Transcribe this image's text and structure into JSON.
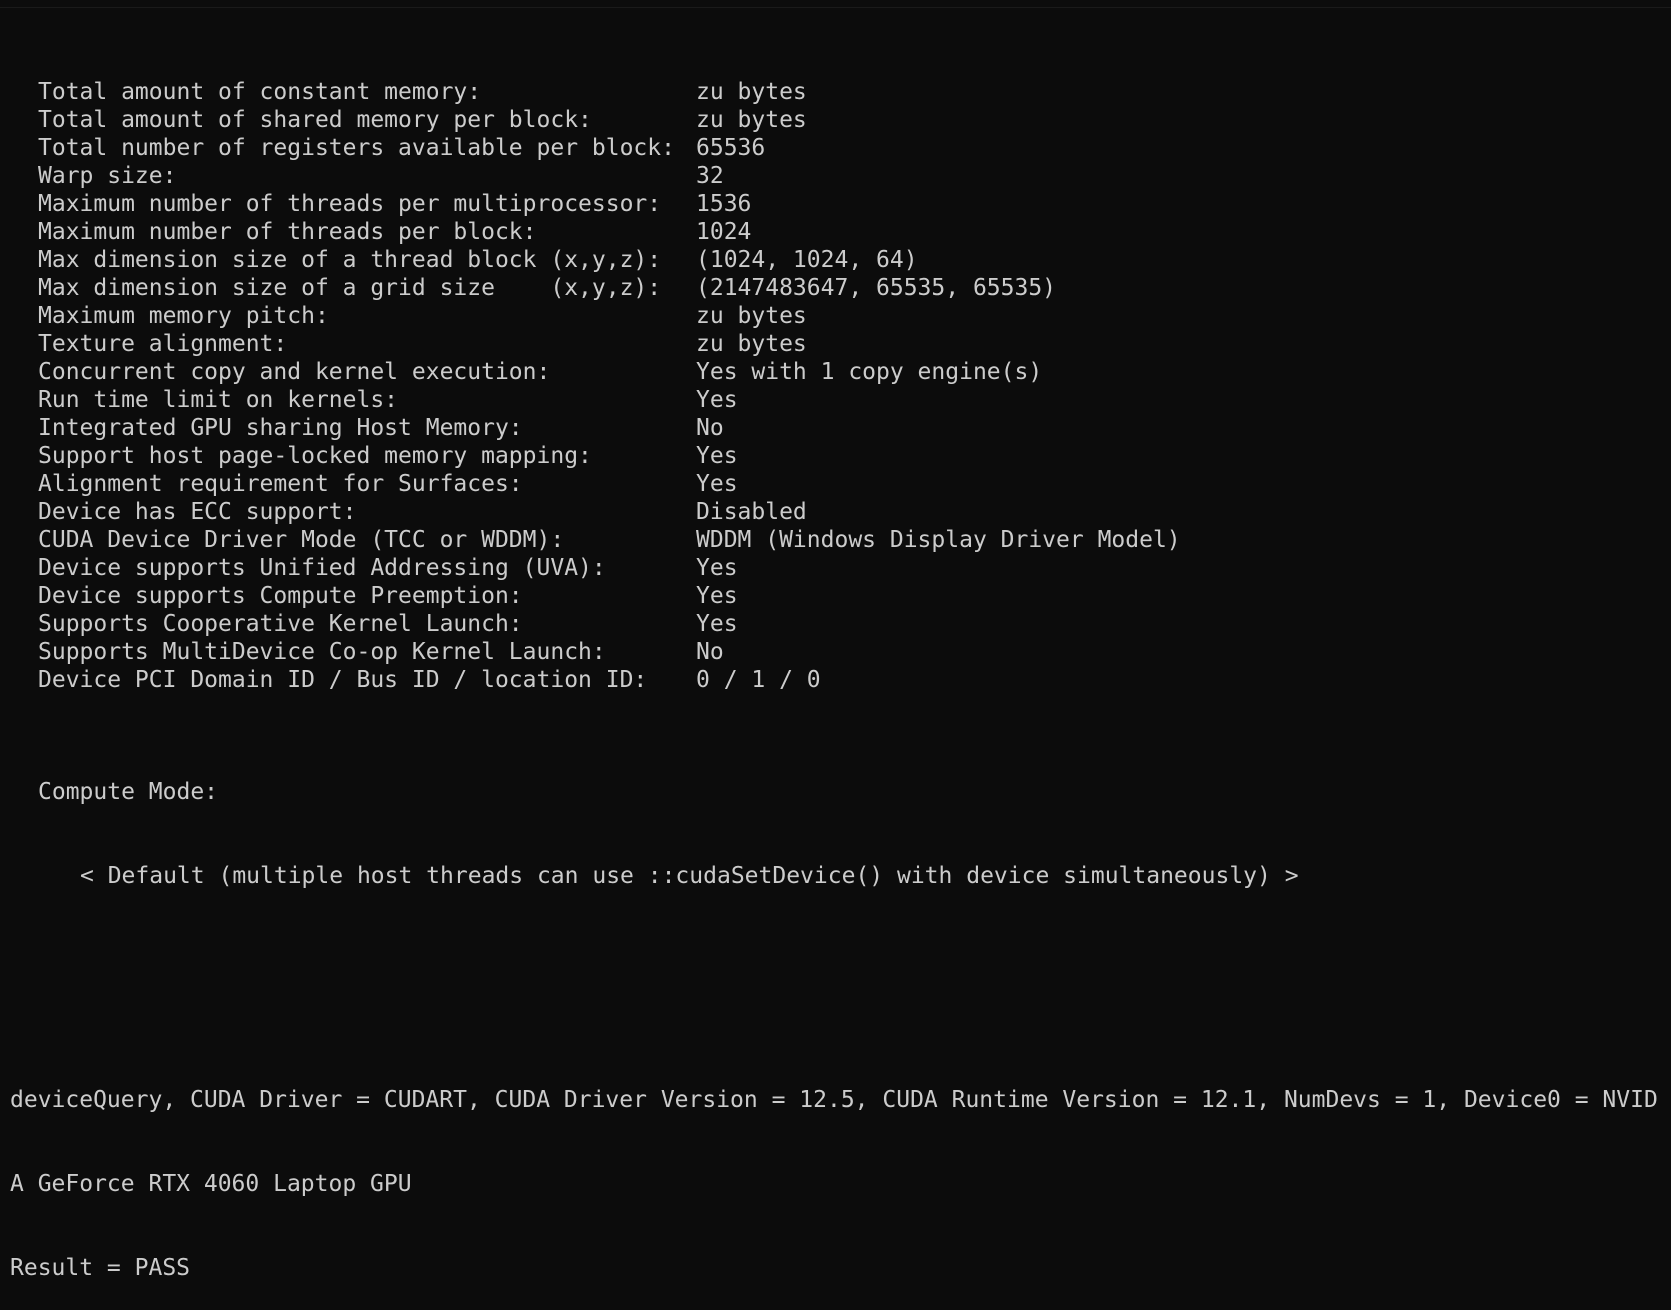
{
  "terminal": {
    "properties": [
      {
        "label": "Total amount of constant memory:",
        "value": "zu bytes"
      },
      {
        "label": "Total amount of shared memory per block:",
        "value": "zu bytes"
      },
      {
        "label": "Total number of registers available per block:",
        "value": "65536"
      },
      {
        "label": "Warp size:",
        "value": "32"
      },
      {
        "label": "Maximum number of threads per multiprocessor:",
        "value": "1536"
      },
      {
        "label": "Maximum number of threads per block:",
        "value": "1024"
      },
      {
        "label": "Max dimension size of a thread block (x,y,z):",
        "value": "(1024, 1024, 64)"
      },
      {
        "label": "Max dimension size of a grid size    (x,y,z):",
        "value": "(2147483647, 65535, 65535)"
      },
      {
        "label": "Maximum memory pitch:",
        "value": "zu bytes"
      },
      {
        "label": "Texture alignment:",
        "value": "zu bytes"
      },
      {
        "label": "Concurrent copy and kernel execution:",
        "value": "Yes with 1 copy engine(s)"
      },
      {
        "label": "Run time limit on kernels:",
        "value": "Yes"
      },
      {
        "label": "Integrated GPU sharing Host Memory:",
        "value": "No"
      },
      {
        "label": "Support host page-locked memory mapping:",
        "value": "Yes"
      },
      {
        "label": "Alignment requirement for Surfaces:",
        "value": "Yes"
      },
      {
        "label": "Device has ECC support:",
        "value": "Disabled"
      },
      {
        "label": "CUDA Device Driver Mode (TCC or WDDM):",
        "value": "WDDM (Windows Display Driver Model)"
      },
      {
        "label": "Device supports Unified Addressing (UVA):",
        "value": "Yes"
      },
      {
        "label": "Device supports Compute Preemption:",
        "value": "Yes"
      },
      {
        "label": "Supports Cooperative Kernel Launch:",
        "value": "Yes"
      },
      {
        "label": "Supports MultiDevice Co-op Kernel Launch:",
        "value": "No"
      },
      {
        "label": "Device PCI Domain ID / Bus ID / location ID:",
        "value": "0 / 1 / 0"
      }
    ],
    "compute_mode_label": "Compute Mode:",
    "compute_mode_value": "< Default (multiple host threads can use ::cudaSetDevice() with device simultaneously) >",
    "summary_line_1": "deviceQuery, CUDA Driver = CUDART, CUDA Driver Version = 12.5, CUDA Runtime Version = 12.1, NumDevs = 1, Device0 = NVID",
    "summary_line_2": "A GeForce RTX 4060 Laptop GPU",
    "result_line": "Result = PASS"
  },
  "colors": {
    "background": "#0c0c0c",
    "foreground": "#cccccc"
  }
}
